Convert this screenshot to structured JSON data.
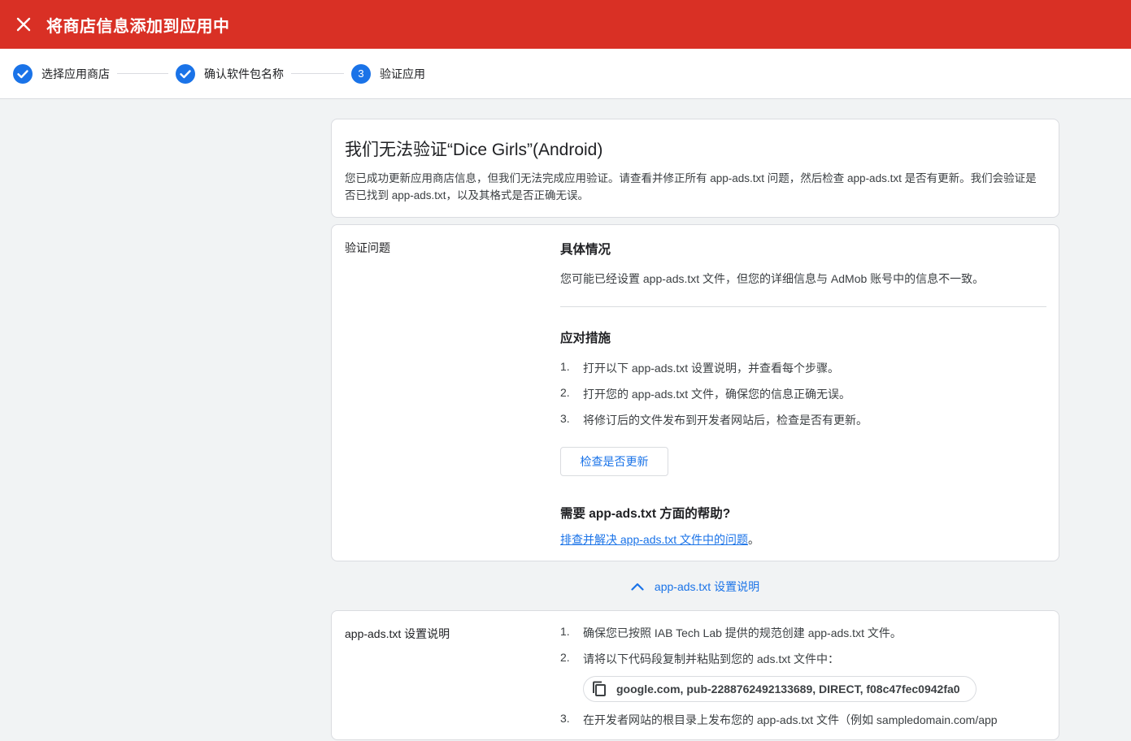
{
  "header": {
    "title": "将商店信息添加到应用中",
    "close_icon": "close-icon"
  },
  "stepper": {
    "steps": [
      {
        "label": "选择应用商店",
        "state": "done"
      },
      {
        "label": "确认软件包名称",
        "state": "done"
      },
      {
        "label": "验证应用",
        "state": "current",
        "number": "3"
      }
    ]
  },
  "summary": {
    "title": "我们无法验证“Dice Girls”(Android)",
    "description": "您已成功更新应用商店信息，但我们无法完成应用验证。请查看并修正所有 app-ads.txt 问题，然后检查 app-ads.txt 是否有更新。我们会验证是否已找到 app-ads.txt，以及其格式是否正确无误。"
  },
  "issue": {
    "section_label": "验证问题",
    "details_heading": "具体情况",
    "details_text": "您可能已经设置 app-ads.txt 文件，但您的详细信息与 AdMob 账号中的信息不一致。",
    "actions_heading": "应对措施",
    "actions": [
      {
        "num": "1.",
        "text": "打开以下 app-ads.txt 设置说明，并查看每个步骤。"
      },
      {
        "num": "2.",
        "text": "打开您的 app-ads.txt 文件，确保您的信息正确无误。"
      },
      {
        "num": "3.",
        "text": "将修订后的文件发布到开发者网站后，检查是否有更新。"
      }
    ],
    "check_button": "检查是否更新",
    "help_heading": "需要 app-ads.txt 方面的帮助?",
    "help_link": "排查并解决 app-ads.txt 文件中的问题",
    "help_suffix": "。"
  },
  "expander": {
    "label": "app-ads.txt 设置说明",
    "icon": "chevron-up-icon"
  },
  "setup": {
    "section_label": "app-ads.txt 设置说明",
    "steps": [
      {
        "num": "1.",
        "text": "确保您已按照 IAB Tech Lab 提供的规范创建 app-ads.txt 文件。"
      },
      {
        "num": "2.",
        "text": "请将以下代码段复制并粘贴到您的 ads.txt 文件中："
      },
      {
        "num": "3.",
        "text": "在开发者网站的根目录上发布您的 app-ads.txt 文件（例如 sampledomain.com/app"
      }
    ],
    "code": "google.com, pub-2288762492133689, DIRECT, f08c47fec0942fa0",
    "copy_icon": "copy-icon"
  },
  "colors": {
    "header_bg": "#d93025",
    "accent": "#1a73e8",
    "page_bg": "#f1f3f4"
  }
}
